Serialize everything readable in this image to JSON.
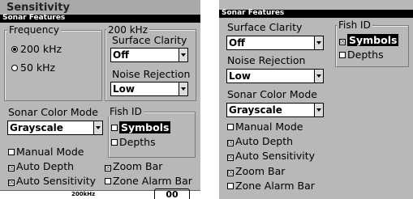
{
  "left": {
    "bg_header": "Sensitivity",
    "title": "Sonar Features",
    "frequency": {
      "legend": "Frequency",
      "options": [
        "200 kHz",
        "50 kHz"
      ],
      "selected": "200 kHz"
    },
    "freq_group": {
      "legend": "200 kHz",
      "surface_clarity_label": "Surface Clarity",
      "surface_clarity_value": "Off",
      "noise_rejection_label": "Noise Rejection",
      "noise_rejection_value": "Low"
    },
    "sonar_color_mode_label": "Sonar Color Mode",
    "sonar_color_mode_value": "Grayscale",
    "fish_id": {
      "legend": "Fish ID",
      "symbols": "Symbols",
      "depths": "Depths"
    },
    "checkboxes": {
      "manual_mode": "Manual Mode",
      "auto_depth": "Auto Depth",
      "auto_sensitivity": "Auto Sensitivity",
      "zoom_bar": "Zoom Bar",
      "zone_alarm_bar": "Zone Alarm Bar"
    },
    "bottom_peek": {
      "text1": "200kHz",
      "text2": "00"
    }
  },
  "right": {
    "title": "Sonar Features",
    "surface_clarity_label": "Surface Clarity",
    "surface_clarity_value": "Off",
    "noise_rejection_label": "Noise Rejection",
    "noise_rejection_value": "Low",
    "sonar_color_mode_label": "Sonar Color Mode",
    "sonar_color_mode_value": "Grayscale",
    "fish_id": {
      "legend": "Fish ID",
      "symbols": "Symbols",
      "depths": "Depths"
    },
    "checkboxes": {
      "manual_mode": "Manual Mode",
      "auto_depth": "Auto Depth",
      "auto_sensitivity": "Auto Sensitivity",
      "zoom_bar": "Zoom Bar",
      "zone_alarm_bar": "Zone Alarm Bar"
    }
  },
  "checkbox_mark": "☒"
}
